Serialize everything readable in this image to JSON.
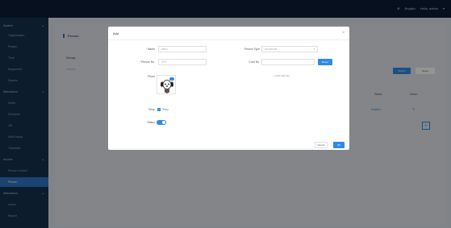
{
  "topbar": {
    "lang_label": "English",
    "user_label": "Hello, admin"
  },
  "sidebar": {
    "items": [
      {
        "label": "System",
        "type": "group"
      },
      {
        "label": "Organization",
        "type": "item"
      },
      {
        "label": "Region",
        "type": "item"
      },
      {
        "label": "Time",
        "type": "item"
      },
      {
        "label": "Equipment",
        "type": "item"
      },
      {
        "label": "System",
        "type": "item"
      },
      {
        "label": "Attendance",
        "type": "group"
      },
      {
        "label": "Shifts",
        "type": "item"
      },
      {
        "label": "Schedule",
        "type": "item"
      },
      {
        "label": "Off",
        "type": "item"
      },
      {
        "label": "Shift Group",
        "type": "item"
      },
      {
        "label": "Timetable",
        "type": "item"
      },
      {
        "label": "Access",
        "type": "group"
      },
      {
        "label": "Person Control",
        "type": "item"
      },
      {
        "label": "Person",
        "type": "item"
      },
      {
        "label": "Attendance",
        "type": "group"
      },
      {
        "label": "Leave",
        "type": "item"
      },
      {
        "label": "Report",
        "type": "item"
      }
    ]
  },
  "page": {
    "title": "Person",
    "group_label": "Group",
    "group_item": "Intranet",
    "search_label": "Search",
    "reset_label": "Reset",
    "col_operation": "Action",
    "col_status": "Status",
    "cell_status": "Enabled",
    "add_label": "+"
  },
  "modal": {
    "title": "Add",
    "close": "×",
    "name_label": "Name",
    "name_value": "demo",
    "person_no_label": "Person No.",
    "person_no_value": "0707",
    "person_type_label": "Person Type",
    "person_type_value": "Household",
    "card_no_label": "Card No.",
    "card_no_value": "",
    "reset_button": "Reset",
    "add_card_label": "+ Add Card No.",
    "photo_label": "Photo",
    "temp_label": "Temp",
    "temp_checkbox_label": "Temp",
    "status_label": "Status",
    "cancel_label": "Cancel",
    "ok_label": "OK"
  },
  "colors": {
    "accent": "#2f8ae6",
    "sidebar_bg": "#17314f",
    "topbar_bg": "#0c1c34"
  }
}
